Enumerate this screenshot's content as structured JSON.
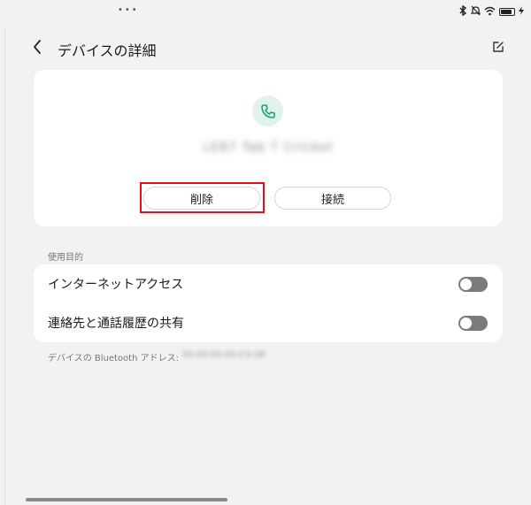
{
  "header": {
    "title": "デバイスの詳細"
  },
  "device": {
    "name": "LE87 Tab T Cricket",
    "delete_label": "削除",
    "connect_label": "接続"
  },
  "section": {
    "label": "使用目的",
    "items": [
      {
        "label": "インターネットアクセス",
        "enabled": false
      },
      {
        "label": "連絡先と通話履歴の共有",
        "enabled": false
      }
    ]
  },
  "bluetooth": {
    "address_label": "デバイスの Bluetooth アドレス:",
    "address_value": "00:00:00:00:C4:08"
  },
  "colors": {
    "accent": "#1aa672",
    "highlight": "#e0101c",
    "toggle_off": "#7b7b7b"
  }
}
